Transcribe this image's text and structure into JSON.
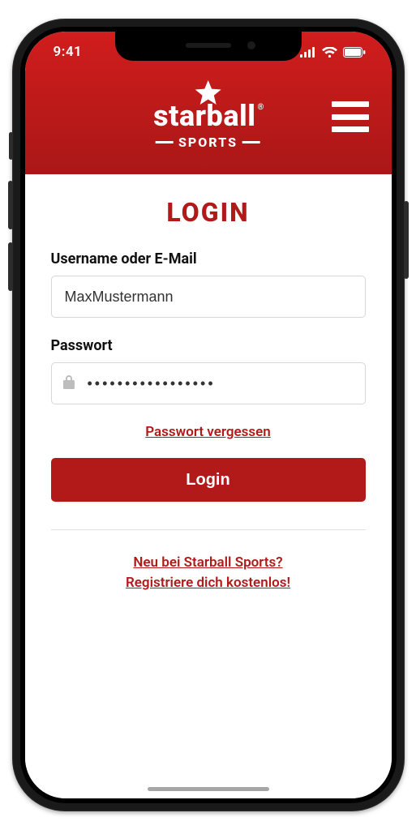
{
  "status": {
    "time": "9:41"
  },
  "brand": {
    "name": "starball",
    "sub": "SPORTS"
  },
  "page": {
    "title": "LOGIN"
  },
  "form": {
    "username_label": "Username oder E-Mail",
    "username_value": "MaxMustermann",
    "password_label": "Passwort",
    "password_value": "•••••••••••••••••",
    "forgot": "Passwort vergessen",
    "login_button": "Login",
    "register_line1": "Neu bei Starball Sports?",
    "register_line2": "Registriere dich kostenlos!"
  },
  "colors": {
    "brand_red": "#b21a1a"
  }
}
